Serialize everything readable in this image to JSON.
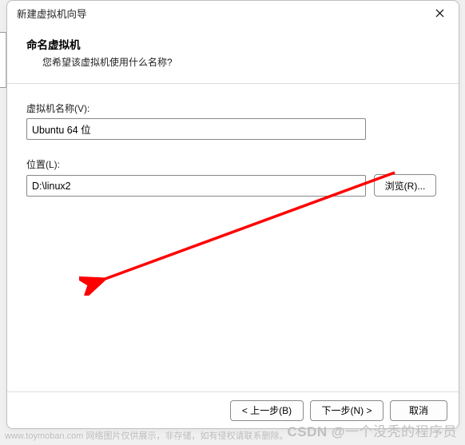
{
  "window": {
    "title": "新建虚拟机向导"
  },
  "header": {
    "title": "命名虚拟机",
    "subtitle": "您希望该虚拟机使用什么名称?"
  },
  "fields": {
    "name_label": "虚拟机名称(V):",
    "name_value": "Ubuntu 64 位",
    "location_label": "位置(L):",
    "location_value": "D:\\linux2",
    "browse_label": "浏览(R)..."
  },
  "footer": {
    "back": "< 上一步(B)",
    "next": "下一步(N) >",
    "cancel": "取消"
  },
  "watermark": {
    "left": "www.toymoban.com 网络图片仅供展示，非存储，如有侵权请联系删除。",
    "right_prefix": "CSDN @",
    "right_name": "一个没秃的程序员"
  }
}
